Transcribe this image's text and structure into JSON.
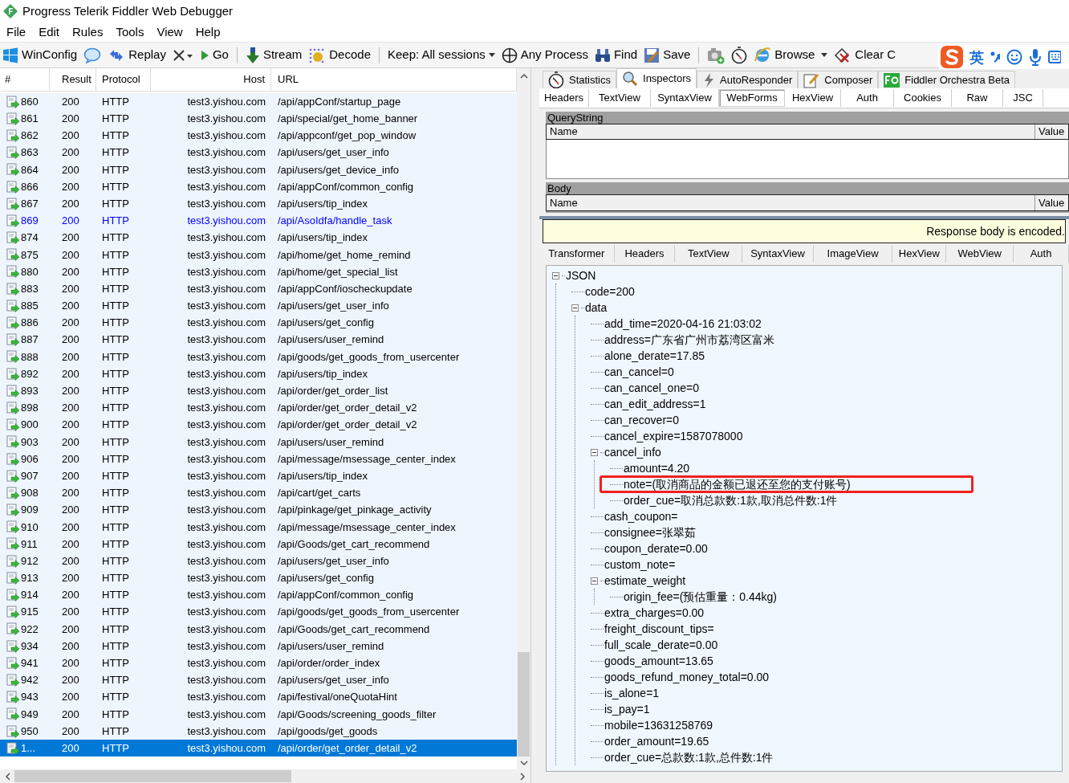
{
  "window": {
    "title": "Progress Telerik Fiddler Web Debugger"
  },
  "menu": [
    "File",
    "Edit",
    "Rules",
    "Tools",
    "View",
    "Help"
  ],
  "toolbar": [
    {
      "kind": "button",
      "label": "WinConfig"
    },
    {
      "kind": "icon"
    },
    {
      "kind": "button",
      "label": "Replay"
    },
    {
      "kind": "icon"
    },
    {
      "kind": "button",
      "label": "Go"
    },
    {
      "kind": "button",
      "label": "Stream"
    },
    {
      "kind": "button",
      "label": "Decode"
    },
    {
      "kind": "dropdown",
      "label": "Keep: All sessions"
    },
    {
      "kind": "button",
      "label": "Any Process"
    },
    {
      "kind": "button",
      "label": "Find"
    },
    {
      "kind": "button",
      "label": "Save"
    },
    {
      "kind": "icon"
    },
    {
      "kind": "icon"
    },
    {
      "kind": "button",
      "label": "Browse"
    },
    {
      "kind": "button",
      "label": "Clear C"
    }
  ],
  "ime_bar": {
    "mode": "英"
  },
  "sessions": {
    "columns": [
      "#",
      "Result",
      "Protocol",
      "Host",
      "URL"
    ],
    "rows": [
      {
        "id": "860",
        "result": "200",
        "protocol": "HTTP",
        "host": "test3.yishou.com",
        "url": "/api/appConf/startup_page",
        "selected": false,
        "color": "#000000"
      },
      {
        "id": "861",
        "result": "200",
        "protocol": "HTTP",
        "host": "test3.yishou.com",
        "url": "/api/special/get_home_banner",
        "selected": false,
        "color": "#000000"
      },
      {
        "id": "862",
        "result": "200",
        "protocol": "HTTP",
        "host": "test3.yishou.com",
        "url": "/api/appconf/get_pop_window",
        "selected": false,
        "color": "#000000"
      },
      {
        "id": "863",
        "result": "200",
        "protocol": "HTTP",
        "host": "test3.yishou.com",
        "url": "/api/users/get_user_info",
        "selected": false,
        "color": "#000000"
      },
      {
        "id": "864",
        "result": "200",
        "protocol": "HTTP",
        "host": "test3.yishou.com",
        "url": "/api/users/get_device_info",
        "selected": false,
        "color": "#000000"
      },
      {
        "id": "866",
        "result": "200",
        "protocol": "HTTP",
        "host": "test3.yishou.com",
        "url": "/api/appConf/common_config",
        "selected": false,
        "color": "#000000"
      },
      {
        "id": "867",
        "result": "200",
        "protocol": "HTTP",
        "host": "test3.yishou.com",
        "url": "/api/users/tip_index",
        "selected": false,
        "color": "#000000"
      },
      {
        "id": "869",
        "result": "200",
        "protocol": "HTTP",
        "host": "test3.yishou.com",
        "url": "/api/AsoIdfa/handle_task",
        "selected": false,
        "color": "#0000ff"
      },
      {
        "id": "874",
        "result": "200",
        "protocol": "HTTP",
        "host": "test3.yishou.com",
        "url": "/api/users/tip_index",
        "selected": false,
        "color": "#000000"
      },
      {
        "id": "875",
        "result": "200",
        "protocol": "HTTP",
        "host": "test3.yishou.com",
        "url": "/api/home/get_home_remind",
        "selected": false,
        "color": "#000000"
      },
      {
        "id": "880",
        "result": "200",
        "protocol": "HTTP",
        "host": "test3.yishou.com",
        "url": "/api/home/get_special_list",
        "selected": false,
        "color": "#000000"
      },
      {
        "id": "883",
        "result": "200",
        "protocol": "HTTP",
        "host": "test3.yishou.com",
        "url": "/api/appConf/ioscheckupdate",
        "selected": false,
        "color": "#000000"
      },
      {
        "id": "885",
        "result": "200",
        "protocol": "HTTP",
        "host": "test3.yishou.com",
        "url": "/api/users/get_user_info",
        "selected": false,
        "color": "#000000"
      },
      {
        "id": "886",
        "result": "200",
        "protocol": "HTTP",
        "host": "test3.yishou.com",
        "url": "/api/users/get_config",
        "selected": false,
        "color": "#000000"
      },
      {
        "id": "887",
        "result": "200",
        "protocol": "HTTP",
        "host": "test3.yishou.com",
        "url": "/api/users/user_remind",
        "selected": false,
        "color": "#000000"
      },
      {
        "id": "888",
        "result": "200",
        "protocol": "HTTP",
        "host": "test3.yishou.com",
        "url": "/api/goods/get_goods_from_usercenter",
        "selected": false,
        "color": "#000000"
      },
      {
        "id": "892",
        "result": "200",
        "protocol": "HTTP",
        "host": "test3.yishou.com",
        "url": "/api/users/tip_index",
        "selected": false,
        "color": "#000000"
      },
      {
        "id": "893",
        "result": "200",
        "protocol": "HTTP",
        "host": "test3.yishou.com",
        "url": "/api/order/get_order_list",
        "selected": false,
        "color": "#000000"
      },
      {
        "id": "898",
        "result": "200",
        "protocol": "HTTP",
        "host": "test3.yishou.com",
        "url": "/api/order/get_order_detail_v2",
        "selected": false,
        "color": "#000000"
      },
      {
        "id": "900",
        "result": "200",
        "protocol": "HTTP",
        "host": "test3.yishou.com",
        "url": "/api/order/get_order_detail_v2",
        "selected": false,
        "color": "#000000"
      },
      {
        "id": "903",
        "result": "200",
        "protocol": "HTTP",
        "host": "test3.yishou.com",
        "url": "/api/users/user_remind",
        "selected": false,
        "color": "#000000"
      },
      {
        "id": "906",
        "result": "200",
        "protocol": "HTTP",
        "host": "test3.yishou.com",
        "url": "/api/message/msessage_center_index",
        "selected": false,
        "color": "#000000"
      },
      {
        "id": "907",
        "result": "200",
        "protocol": "HTTP",
        "host": "test3.yishou.com",
        "url": "/api/users/tip_index",
        "selected": false,
        "color": "#000000"
      },
      {
        "id": "908",
        "result": "200",
        "protocol": "HTTP",
        "host": "test3.yishou.com",
        "url": "/api/cart/get_carts",
        "selected": false,
        "color": "#000000"
      },
      {
        "id": "909",
        "result": "200",
        "protocol": "HTTP",
        "host": "test3.yishou.com",
        "url": "/api/pinkage/get_pinkage_activity",
        "selected": false,
        "color": "#000000"
      },
      {
        "id": "910",
        "result": "200",
        "protocol": "HTTP",
        "host": "test3.yishou.com",
        "url": "/api/message/msessage_center_index",
        "selected": false,
        "color": "#000000"
      },
      {
        "id": "911",
        "result": "200",
        "protocol": "HTTP",
        "host": "test3.yishou.com",
        "url": "/api/Goods/get_cart_recommend",
        "selected": false,
        "color": "#000000"
      },
      {
        "id": "912",
        "result": "200",
        "protocol": "HTTP",
        "host": "test3.yishou.com",
        "url": "/api/users/get_user_info",
        "selected": false,
        "color": "#000000"
      },
      {
        "id": "913",
        "result": "200",
        "protocol": "HTTP",
        "host": "test3.yishou.com",
        "url": "/api/users/get_config",
        "selected": false,
        "color": "#000000"
      },
      {
        "id": "914",
        "result": "200",
        "protocol": "HTTP",
        "host": "test3.yishou.com",
        "url": "/api/appConf/common_config",
        "selected": false,
        "color": "#000000"
      },
      {
        "id": "915",
        "result": "200",
        "protocol": "HTTP",
        "host": "test3.yishou.com",
        "url": "/api/goods/get_goods_from_usercenter",
        "selected": false,
        "color": "#000000"
      },
      {
        "id": "922",
        "result": "200",
        "protocol": "HTTP",
        "host": "test3.yishou.com",
        "url": "/api/Goods/get_cart_recommend",
        "selected": false,
        "color": "#000000"
      },
      {
        "id": "934",
        "result": "200",
        "protocol": "HTTP",
        "host": "test3.yishou.com",
        "url": "/api/users/user_remind",
        "selected": false,
        "color": "#000000"
      },
      {
        "id": "941",
        "result": "200",
        "protocol": "HTTP",
        "host": "test3.yishou.com",
        "url": "/api/order/order_index",
        "selected": false,
        "color": "#000000"
      },
      {
        "id": "942",
        "result": "200",
        "protocol": "HTTP",
        "host": "test3.yishou.com",
        "url": "/api/users/get_user_info",
        "selected": false,
        "color": "#000000"
      },
      {
        "id": "943",
        "result": "200",
        "protocol": "HTTP",
        "host": "test3.yishou.com",
        "url": "/api/festival/oneQuotaHint",
        "selected": false,
        "color": "#000000"
      },
      {
        "id": "949",
        "result": "200",
        "protocol": "HTTP",
        "host": "test3.yishou.com",
        "url": "/api/Goods/screening_goods_filter",
        "selected": false,
        "color": "#000000"
      },
      {
        "id": "950",
        "result": "200",
        "protocol": "HTTP",
        "host": "test3.yishou.com",
        "url": "/api/goods/get_goods",
        "selected": false,
        "color": "#000000"
      },
      {
        "id": "1...",
        "result": "200",
        "protocol": "HTTP",
        "host": "test3.yishou.com",
        "url": "/api/order/get_order_detail_v2",
        "selected": true,
        "color": "#ffffff"
      }
    ]
  },
  "main_tabs": [
    {
      "label": "Statistics",
      "selected": false
    },
    {
      "label": "Inspectors",
      "selected": true
    },
    {
      "label": "AutoResponder",
      "selected": false
    },
    {
      "label": "Composer",
      "selected": false
    },
    {
      "label": "Fiddler Orchestra Beta",
      "selected": false
    }
  ],
  "request_tabs": [
    {
      "label": "Headers",
      "selected": false
    },
    {
      "label": "TextView",
      "selected": false
    },
    {
      "label": "SyntaxView",
      "selected": false
    },
    {
      "label": "WebForms",
      "selected": true
    },
    {
      "label": "HexView",
      "selected": false
    },
    {
      "label": "Auth",
      "selected": false
    },
    {
      "label": "Cookies",
      "selected": false
    },
    {
      "label": "Raw",
      "selected": false
    },
    {
      "label": "JSC",
      "selected": false
    }
  ],
  "querystring": {
    "title": "QueryString",
    "columns": [
      "Name",
      "Value"
    ]
  },
  "body": {
    "title": "Body",
    "columns": [
      "Name",
      "Value"
    ]
  },
  "notice": "Response body is encoded.",
  "response_tabs": [
    {
      "label": "Transformer",
      "selected": false
    },
    {
      "label": "Headers",
      "selected": false
    },
    {
      "label": "TextView",
      "selected": false
    },
    {
      "label": "SyntaxView",
      "selected": false
    },
    {
      "label": "ImageView",
      "selected": false
    },
    {
      "label": "HexView",
      "selected": false
    },
    {
      "label": "WebView",
      "selected": false
    },
    {
      "label": "Auth",
      "selected": false
    }
  ],
  "tree": [
    {
      "text": "JSON",
      "expanded": true,
      "children": [
        {
          "text": "code=200"
        },
        {
          "text": "data",
          "expanded": true,
          "children": [
            {
              "text": "add_time=2020-04-16 21:03:02"
            },
            {
              "text": "address=广东省广州市荔湾区富米"
            },
            {
              "text": "alone_derate=17.85"
            },
            {
              "text": "can_cancel=0"
            },
            {
              "text": "can_cancel_one=0"
            },
            {
              "text": "can_edit_address=1"
            },
            {
              "text": "can_recover=0"
            },
            {
              "text": "cancel_expire=1587078000"
            },
            {
              "text": "cancel_info",
              "expanded": true,
              "children": [
                {
                  "text": "amount=4.20"
                },
                {
                  "text": "note=(取消商品的金额已退还至您的支付账号)",
                  "highlighted": true
                },
                {
                  "text": "order_cue=取消总款数:1款,取消总件数:1件"
                }
              ]
            },
            {
              "text": "cash_coupon="
            },
            {
              "text": "consignee=张翠茹"
            },
            {
              "text": "coupon_derate=0.00"
            },
            {
              "text": "custom_note="
            },
            {
              "text": "estimate_weight",
              "expanded": true,
              "children": [
                {
                  "text": "origin_fee=(预估重量：0.44kg)"
                }
              ]
            },
            {
              "text": "extra_charges=0.00"
            },
            {
              "text": "freight_discount_tips="
            },
            {
              "text": "full_scale_derate=0.00"
            },
            {
              "text": "goods_amount=13.65"
            },
            {
              "text": "goods_refund_money_total=0.00"
            },
            {
              "text": "is_alone=1"
            },
            {
              "text": "is_pay=1"
            },
            {
              "text": "mobile=13631258769"
            },
            {
              "text": "order_amount=19.65"
            },
            {
              "text": "order_cue=总款数:1款,总件数:1件"
            }
          ]
        }
      ]
    }
  ]
}
